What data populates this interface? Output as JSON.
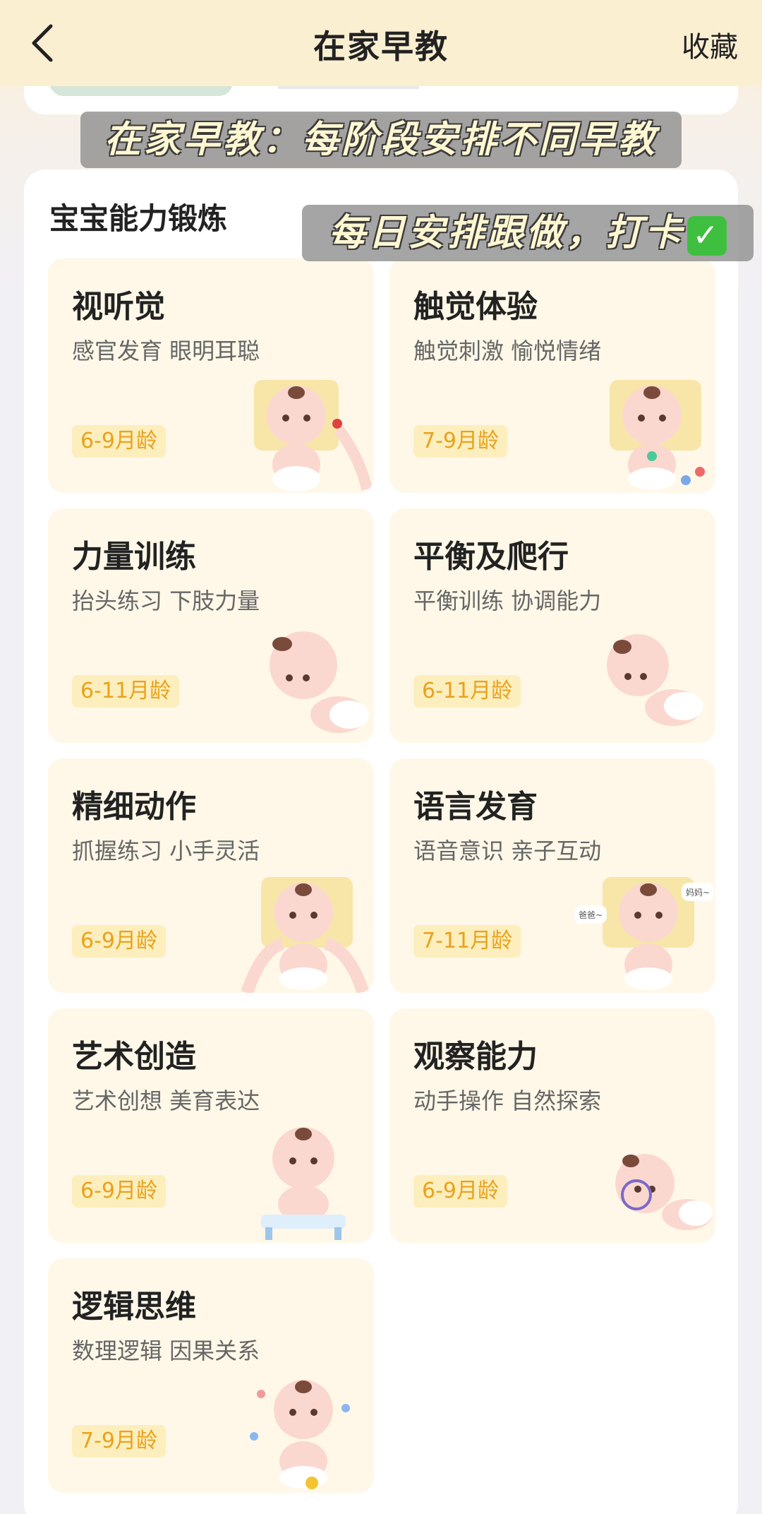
{
  "header": {
    "title": "在家早教",
    "favorite_label": "收藏"
  },
  "overlays": {
    "caption_1": "在家早教：每阶段安排不同早教",
    "caption_2": "每日安排跟做，打卡"
  },
  "section": {
    "title": "宝宝能力锻炼"
  },
  "tiles": [
    {
      "title": "视听觉",
      "desc": "感官发育 眼明耳聪",
      "age": "6-9月龄"
    },
    {
      "title": "触觉体验",
      "desc": "触觉刺激 愉悦情绪",
      "age": "7-9月龄"
    },
    {
      "title": "力量训练",
      "desc": "抬头练习 下肢力量",
      "age": "6-11月龄"
    },
    {
      "title": "平衡及爬行",
      "desc": "平衡训练 协调能力",
      "age": "6-11月龄"
    },
    {
      "title": "精细动作",
      "desc": "抓握练习 小手灵活",
      "age": "6-9月龄"
    },
    {
      "title": "语言发育",
      "desc": "语音意识 亲子互动",
      "age": "7-11月龄",
      "bubbles": [
        "爸爸~",
        "妈妈~"
      ]
    },
    {
      "title": "艺术创造",
      "desc": "艺术创想 美育表达",
      "age": "6-9月龄"
    },
    {
      "title": "观察能力",
      "desc": "动手操作 自然探索",
      "age": "6-9月龄"
    },
    {
      "title": "逻辑思维",
      "desc": "数理逻辑 因果关系",
      "age": "7-9月龄"
    }
  ],
  "colors": {
    "header_bg": "#fbefd2",
    "tile_bg": "#fff8e8",
    "age_badge_bg": "#fdeebd",
    "age_badge_text": "#e8a21d"
  }
}
